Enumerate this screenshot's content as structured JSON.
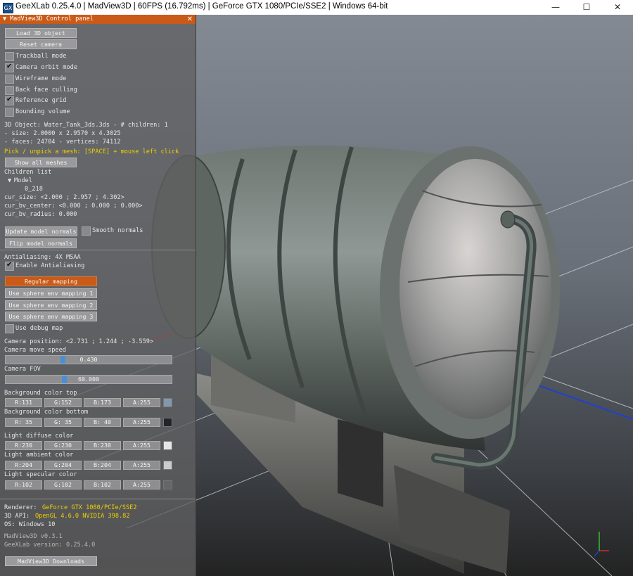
{
  "window": {
    "title": "GeeXLab 0.25.4.0 | MadView3D | 60FPS (16.792ms) | GeForce GTX 1080/PCIe/SSE2 | Windows 64-bit",
    "icon_label": "GX",
    "minimize_glyph": "—",
    "maximize_glyph": "☐",
    "close_glyph": "✕"
  },
  "panel": {
    "title": "MadView3D Control panel",
    "collapse_glyph": "▼",
    "close_glyph": "✕",
    "load_button": "Load 3D object",
    "reset_camera_button": "Reset camera",
    "options": [
      {
        "label": "Trackball mode",
        "checked": false
      },
      {
        "label": "Camera orbit mode",
        "checked": true
      },
      {
        "label": "Wireframe mode",
        "checked": false
      },
      {
        "label": "Back face culling",
        "checked": false
      },
      {
        "label": "Reference grid",
        "checked": true
      },
      {
        "label": "Bounding volume",
        "checked": false
      }
    ],
    "object_info": {
      "line1": "3D Object: Water_Tank_3ds.3ds - # children: 1",
      "line2": "- size:  2.0000 x 2.9570 x 4.3025",
      "line3": "- faces: 24704 - vertices: 74112"
    },
    "pick_hint": "Pick / unpick a mesh: [SPACE] + mouse left click",
    "show_all_button": "Show all meshes",
    "children_list_label": "Children list",
    "tree_root_glyph": "▼",
    "tree_root": "Model",
    "tree_child": "0_218",
    "cur_size": "cur_size: <2.000 ; 2.957 ; 4.302>",
    "cur_bv_center": "cur_bv_center: <0.000 ; 0.000 ; 0.000>",
    "cur_bv_radius": "cur_bv_radius: 0.000",
    "update_normals_button": "Update model normals",
    "smooth_normals_label": "Smooth normals",
    "smooth_normals_checked": false,
    "flip_normals_button": "Flip model normals",
    "antialiasing_info": "Antialiasing: 4X MSAA",
    "enable_aa_label": "Enable Antialiasing",
    "enable_aa_checked": true,
    "mapping_buttons": [
      "Regular mapping",
      "Use sphere env mapping 1",
      "Use sphere env mapping 2",
      "Use sphere env mapping 3"
    ],
    "active_mapping_index": 0,
    "debug_map_label": "Use debug map",
    "debug_map_checked": false,
    "camera_position": "Camera position: <2.731 ; 1.244 ; -3.559>",
    "move_speed_label": "Camera move speed",
    "move_speed_value": "0.430",
    "move_speed_fraction": 0.34,
    "fov_label": "Camera FOV",
    "fov_value": "60.000",
    "fov_fraction": 0.35,
    "colors": [
      {
        "label": "Background color top",
        "r": "R:131",
        "g": "G:152",
        "b": "B:173",
        "a": "A:255",
        "swatch": "#8398ad"
      },
      {
        "label": "Background color bottom",
        "r": "R: 35",
        "g": "G: 35",
        "b": "B: 40",
        "a": "A:255",
        "swatch": "#232328"
      },
      {
        "label": "Light diffuse color",
        "r": "R:230",
        "g": "G:230",
        "b": "B:230",
        "a": "A:255",
        "swatch": "#e6e6e6"
      },
      {
        "label": "Light ambient color",
        "r": "R:204",
        "g": "G:204",
        "b": "B:204",
        "a": "A:255",
        "swatch": "#cccccc"
      },
      {
        "label": "Light specular color",
        "r": "R:102",
        "g": "G:102",
        "b": "B:102",
        "a": "A:255",
        "swatch": "#666666"
      }
    ],
    "renderer_label": "Renderer:",
    "renderer_value": "GeForce GTX 1080/PCIe/SSE2",
    "api_label": "3D API:",
    "api_value": "OpenGL 4.6.0 NVIDIA 398.82",
    "os_info": "OS: Windows 10",
    "madview_version": "MadView3D v0.3.1",
    "geexlab_version": "GeeXLab version: 0.25.4.0",
    "downloads_button": "MadView3D Downloads"
  }
}
